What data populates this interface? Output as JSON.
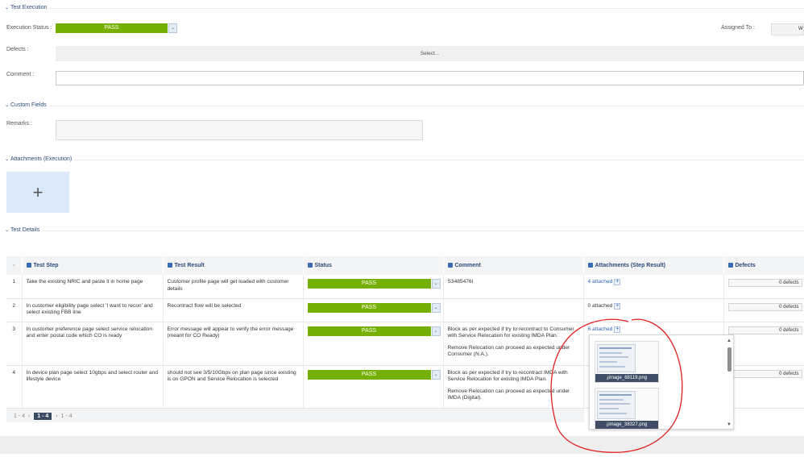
{
  "sections": {
    "test_execution": "Test Execution",
    "custom_fields": "Custom Fields",
    "attachments": "Attachments (Execution)",
    "test_details": "Test Details"
  },
  "execution": {
    "status_label": "Execution Status :",
    "status_value": "PASS",
    "status_color": "#75b000",
    "assigned_label": "Assigned To :",
    "assigned_value": "W",
    "defects_label": "Defects :",
    "defects_placeholder": "Select...",
    "comment_label": "Comment :",
    "comment_value": ""
  },
  "custom_fields": {
    "remarks_label": "Remarks :",
    "remarks_value": ""
  },
  "attachments": {
    "add_symbol": "+"
  },
  "table": {
    "headers": {
      "index": "-",
      "step": "Test Step",
      "result": "Test Result",
      "status": "Status",
      "comment": "Comment",
      "attachments": "Attachments (Step Result)",
      "defects": "Defects"
    },
    "rows": [
      {
        "n": "1",
        "step": "Take the existing NRIC and paste it in home page",
        "result": "Customer profile page will get loaded with customer details",
        "status": "PASS",
        "comment1": "S3485476I",
        "comment2": "",
        "attach": "4 attached",
        "defects": "0 defects"
      },
      {
        "n": "2",
        "step": "In customer eligibility page select 'I want to recon' and select existing FBB line",
        "result": "Recontract flow will be selected",
        "status": "PASS",
        "comment1": "",
        "comment2": "",
        "attach": "0 attached",
        "defects": "0 defects"
      },
      {
        "n": "3",
        "step": "In customer preference page select service relocation and enter postal code which CO is ready",
        "result": "Error message will appear to verify the error message (meant for CO Ready)",
        "status": "PASS",
        "comment1": "Block as per expected if try to recontract to Consumer with Service Relocation for existing IMDA Plan.",
        "comment2": "Remove Relocation can proceed as expected under Consumer (N.A.).",
        "attach": "6 attached",
        "defects": "0 defects"
      },
      {
        "n": "4",
        "step": "In device plan page select 10gbps and select router and lifestyle device",
        "result": "should not see 3/5/10Gbps on plan page since existing is on GPON and Service Relocation is selected",
        "status": "PASS",
        "comment1": "Block as per expected if try to recontract IMDA with Service Relocation for existing IMDA Plan.",
        "comment2": "Remove Relocation can proceed as expected under IMDA (Digital).",
        "attach": "",
        "defects": "0 defects"
      }
    ]
  },
  "pager": {
    "range": "1 - 4",
    "prev": "‹",
    "current": "1 - 4",
    "next": "›",
    "total": "1 - 4"
  },
  "popup": {
    "files": [
      "image_68119.png",
      "image_38327.png"
    ]
  },
  "annotation_color": "#e02020",
  "icons": [
    "chevron-down-icon",
    "plus-icon",
    "download-icon",
    "scroll-up-icon",
    "scroll-down-icon"
  ]
}
